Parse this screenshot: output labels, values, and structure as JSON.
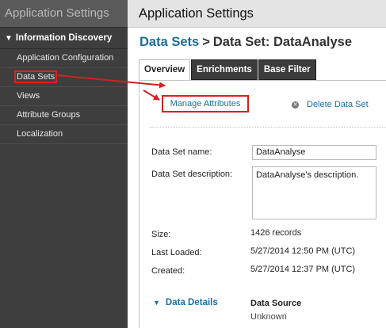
{
  "sidebar": {
    "title": "Application Settings",
    "section": "Information Discovery",
    "items": [
      {
        "label": "Application Configuration"
      },
      {
        "label": "Data Sets"
      },
      {
        "label": "Views"
      },
      {
        "label": "Attribute Groups"
      },
      {
        "label": "Localization"
      }
    ]
  },
  "main": {
    "title": "Application Settings",
    "breadcrumb": {
      "link": "Data Sets",
      "separator": ">",
      "current": "Data Set: DataAnalyse"
    },
    "tabs": [
      {
        "label": "Overview",
        "active": true
      },
      {
        "label": "Enrichments"
      },
      {
        "label": "Base Filter"
      }
    ],
    "actions": {
      "manage": "Manage Attributes",
      "delete": "Delete Data Set"
    },
    "fields": {
      "name_label": "Data Set name:",
      "name_value": "DataAnalyse",
      "desc_label": "Data Set description:",
      "desc_value": "DataAnalyse's description.",
      "size_label": "Size:",
      "size_value": "1426 records",
      "loaded_label": "Last Loaded:",
      "loaded_value": "5/27/2014 12:50 PM (UTC)",
      "created_label": "Created:",
      "created_value": "5/27/2014 12:37 PM (UTC)"
    },
    "details": {
      "toggle": "Data Details",
      "source_label": "Data Source",
      "source_value": "Unknown"
    }
  },
  "colors": {
    "annotation": "#d42020",
    "link": "#1a6fa0",
    "sidebar_bg": "#3e3e3e"
  },
  "icons": [
    "triangle-down-icon",
    "delete-x-icon"
  ]
}
